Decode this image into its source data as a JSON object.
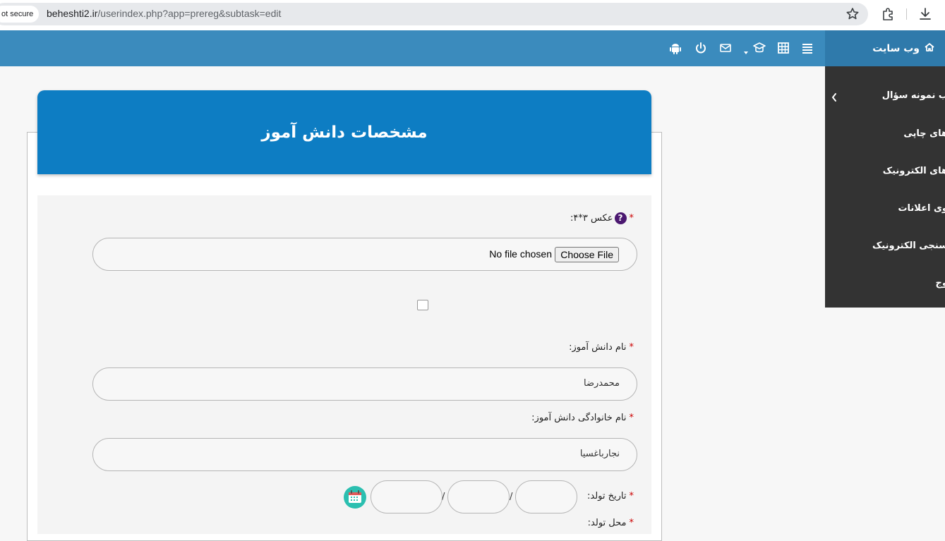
{
  "browser": {
    "security_label": "ot secure",
    "url_host": "beheshti2.ir",
    "url_path": "/userindex.php?app=prereg&subtask=edit",
    "icons": [
      "star-icon",
      "extensions-icon",
      "download-icon"
    ]
  },
  "navbar": {
    "brand_label": "وب سایت",
    "icons": [
      "home-icon",
      "list-icon",
      "grid-icon",
      "graduation-icon",
      "dropdown-caret-icon",
      "mail-icon",
      "power-icon",
      "android-icon"
    ]
  },
  "sidemenu": {
    "items": [
      {
        "label": "ب نمونه سؤال"
      },
      {
        "label": "های چاپی"
      },
      {
        "label": "های الکترونیک"
      },
      {
        "label": "وی اعلانات"
      },
      {
        "label": "سنجی الکترونیک"
      },
      {
        "label": "وج"
      }
    ]
  },
  "form": {
    "title": "مشخصات دانش آموز",
    "photo_label": "عکس ۳*۴:",
    "file_button": "Choose File",
    "file_status": "No file chosen",
    "first_name_label": "نام دانش آموز:",
    "first_name_value": "محمدرضا",
    "last_name_label": "نام خانوادگی دانش آموز:",
    "last_name_value": "نجارباغسیا",
    "birth_date_label": "تاریخ تولد:",
    "date_separator": "/",
    "birth_place_label": "محل تولد:",
    "required_mark": "*",
    "help_mark": "?"
  },
  "colors": {
    "navbar": "#3b8bbd",
    "brand": "#2f7aab",
    "sidemenu": "#333333",
    "form_header": "#0d7dc3",
    "required": "#cc0000",
    "calendar": "#2bbfb0"
  }
}
